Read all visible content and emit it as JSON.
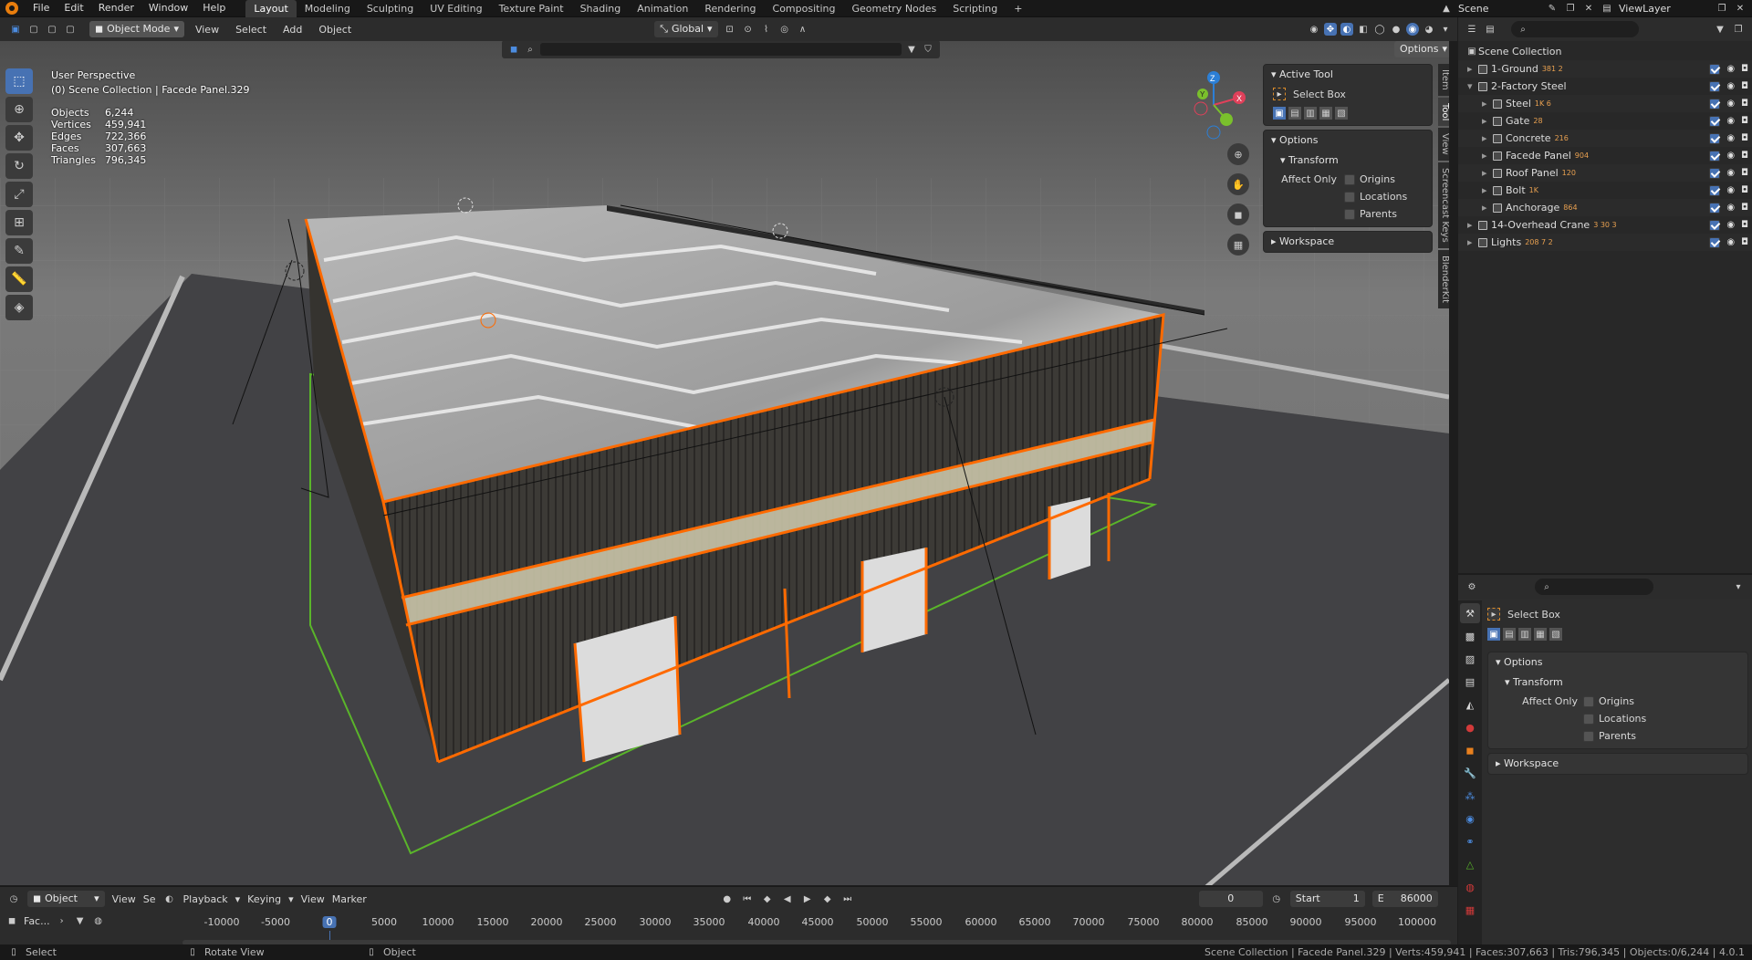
{
  "topbar": {
    "menus": [
      "File",
      "Edit",
      "Render",
      "Window",
      "Help"
    ],
    "workspaces": [
      "Layout",
      "Modeling",
      "Sculpting",
      "UV Editing",
      "Texture Paint",
      "Shading",
      "Animation",
      "Rendering",
      "Compositing",
      "Geometry Nodes",
      "Scripting"
    ],
    "active_workspace": "Layout",
    "scene": "Scene",
    "view_layer": "ViewLayer"
  },
  "viewport_header": {
    "mode": "Object Mode",
    "menus": [
      "View",
      "Select",
      "Add",
      "Object"
    ],
    "orientation": "Global",
    "options": "Options"
  },
  "overlay": {
    "perspective": "User Perspective",
    "context": "(0) Scene Collection | Facede Panel.329"
  },
  "stats": [
    {
      "label": "Objects",
      "value": "6,244"
    },
    {
      "label": "Vertices",
      "value": "459,941"
    },
    {
      "label": "Edges",
      "value": "722,366"
    },
    {
      "label": "Faces",
      "value": "307,663"
    },
    {
      "label": "Triangles",
      "value": "796,345"
    }
  ],
  "npanel": {
    "active_tool_header": "Active Tool",
    "tool_name": "Select Box",
    "options_header": "Options",
    "transform_header": "Transform",
    "affect_only": "Affect Only",
    "checkboxes": [
      "Origins",
      "Locations",
      "Parents"
    ],
    "workspace_header": "Workspace",
    "tabs": [
      "Item",
      "Tool",
      "View",
      "Screencast Keys",
      "BlenderKit"
    ]
  },
  "outliner": {
    "root": "Scene Collection",
    "items": [
      {
        "name": "1-Ground",
        "indent": 1,
        "badges": "381  2"
      },
      {
        "name": "2-Factory Steel",
        "indent": 1,
        "badges": ""
      },
      {
        "name": "Steel",
        "indent": 2,
        "badges": "1K  6"
      },
      {
        "name": "Gate",
        "indent": 2,
        "badges": "28"
      },
      {
        "name": "Concrete",
        "indent": 2,
        "badges": "216"
      },
      {
        "name": "Facede Panel",
        "indent": 2,
        "badges": "904"
      },
      {
        "name": "Roof Panel",
        "indent": 2,
        "badges": "120"
      },
      {
        "name": "Bolt",
        "indent": 2,
        "badges": "1K"
      },
      {
        "name": "Anchorage",
        "indent": 2,
        "badges": "864"
      },
      {
        "name": "14-Overhead Crane",
        "indent": 1,
        "badges": "3  30  3"
      },
      {
        "name": "Lights",
        "indent": 1,
        "badges": "208  7  2"
      }
    ]
  },
  "properties": {
    "tool_name": "Select Box",
    "options_header": "Options",
    "transform_header": "Transform",
    "affect_only": "Affect Only",
    "checkboxes": [
      "Origins",
      "Locations",
      "Parents"
    ],
    "workspace_header": "Workspace"
  },
  "timeline": {
    "editor": "Object",
    "menus": [
      "View",
      "Se"
    ],
    "playback": "Playback",
    "keying": "Keying",
    "view": "View",
    "marker": "Marker",
    "current_frame": "0",
    "start_label": "Start",
    "start": "1",
    "end_label": "E",
    "end": "86000",
    "ticks": [
      "-10000",
      "-5000",
      "0",
      "5000",
      "10000",
      "15000",
      "20000",
      "25000",
      "30000",
      "35000",
      "40000",
      "45000",
      "50000",
      "55000",
      "60000",
      "65000",
      "70000",
      "75000",
      "80000",
      "85000",
      "90000",
      "95000",
      "100000"
    ],
    "left_label": "Fac..."
  },
  "statusbar": {
    "select": "Select",
    "rotate": "Rotate View",
    "object": "Object",
    "info": "Scene Collection | Facede Panel.329 | Verts:459,941 | Faces:307,663 | Tris:796,345 | Objects:0/6,244 | 4.0.1"
  },
  "colors": {
    "accent": "#4772b3",
    "selection": "#ff6a00",
    "grid_green": "#5ab52a",
    "blender_orange": "#e87d0d"
  }
}
